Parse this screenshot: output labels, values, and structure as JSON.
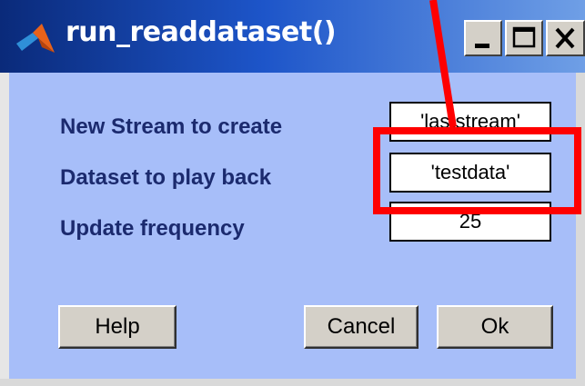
{
  "window": {
    "title": "run_readdataset()",
    "title_icon": "matlab-logo-icon",
    "controls": [
      "minimize-icon",
      "maximize-icon",
      "close-icon"
    ]
  },
  "form": {
    "rows": [
      {
        "label": "New Stream to create",
        "value": "'laststream'"
      },
      {
        "label": "Dataset to play back",
        "value": "'testdata'"
      },
      {
        "label": "Update frequency",
        "value": "25"
      }
    ]
  },
  "buttons": {
    "help": "Help",
    "cancel": "Cancel",
    "ok": "Ok"
  },
  "annotation": {
    "color": "#ff0000"
  }
}
